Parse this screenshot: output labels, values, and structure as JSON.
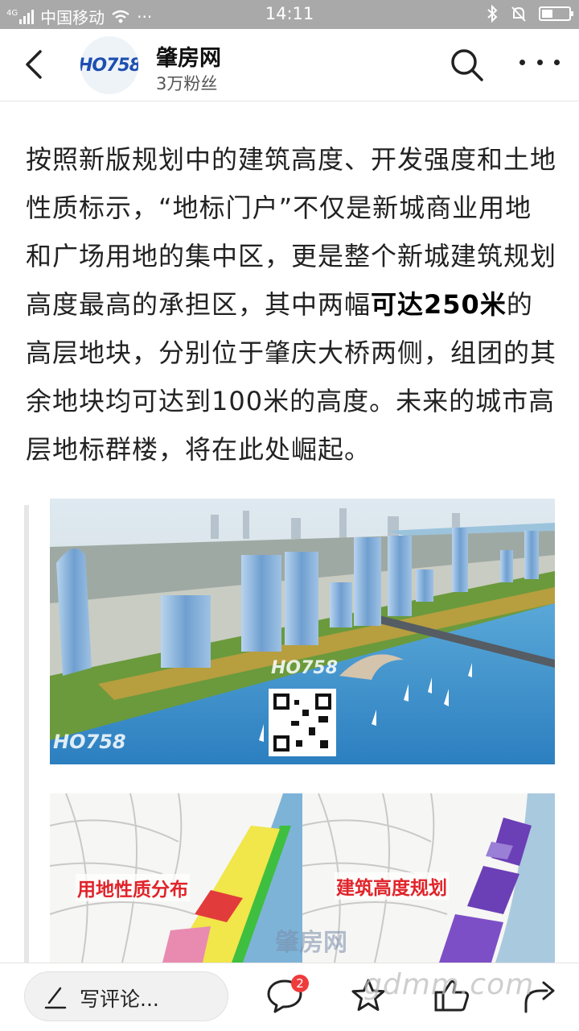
{
  "status_bar": {
    "network_type": "4G",
    "carrier": "中国移动",
    "overflow": "···",
    "time": "14:11",
    "battery_level": 0.4
  },
  "header": {
    "account_name": "肇房网",
    "fans": "3万粉丝",
    "logo_text": "HO758"
  },
  "article": {
    "text_before": "按照新版规划中的建筑高度、开发强度和土地性质标示，“地标门户”不仅是新城商业用地和广场用地的集中区，更是整个新城建筑规划高度最高的承担区，其中两幅",
    "text_bold": "可达250米",
    "text_after": "的高层地块，分别位于肇庆大桥两侧，组团的其余地块均可达到100米的高度。未来的城市高层地标群楼，将在此处崛起。"
  },
  "images": {
    "photo_watermark": "HO758",
    "map_left_label": "用地性质分布",
    "map_right_label": "建筑高度规划",
    "map_watermark": "肇房网"
  },
  "bottom_bar": {
    "comment_placeholder": "写评论...",
    "comment_count": "2",
    "site_watermark": "gdmm.com"
  }
}
